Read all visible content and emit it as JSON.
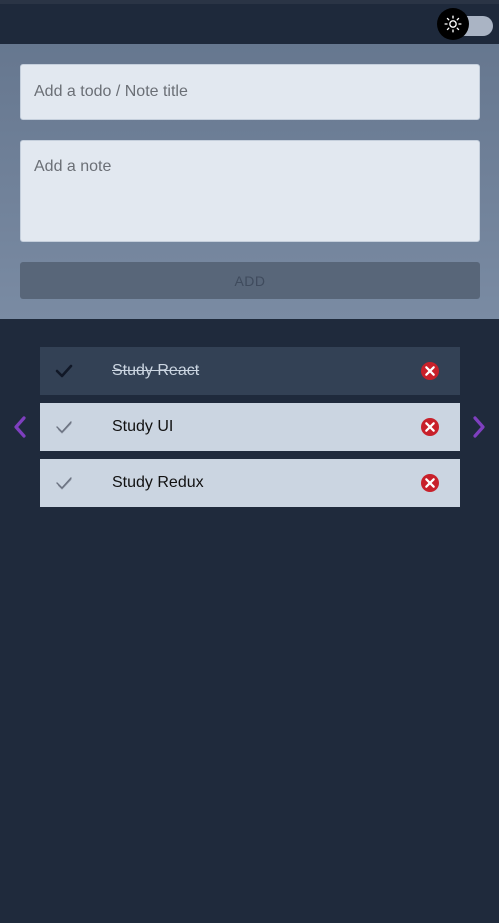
{
  "header": {
    "theme_toggle_icon": "sun-icon"
  },
  "form": {
    "title_placeholder": "Add a todo / Note title",
    "title_value": "",
    "note_placeholder": "Add a note",
    "note_value": "",
    "add_label": "ADD"
  },
  "todos": [
    {
      "title": "Study React",
      "completed": true
    },
    {
      "title": "Study UI",
      "completed": false
    },
    {
      "title": "Study Redux",
      "completed": false
    }
  ],
  "colors": {
    "accent_arrow": "#7e3fbf",
    "delete_red": "#c8202a",
    "completed_row": "#334155",
    "open_row": "#cbd5e1"
  },
  "icons": {
    "prev": "chevron-left-icon",
    "next": "chevron-right-icon",
    "check": "check-icon",
    "delete": "delete-circle-icon"
  }
}
